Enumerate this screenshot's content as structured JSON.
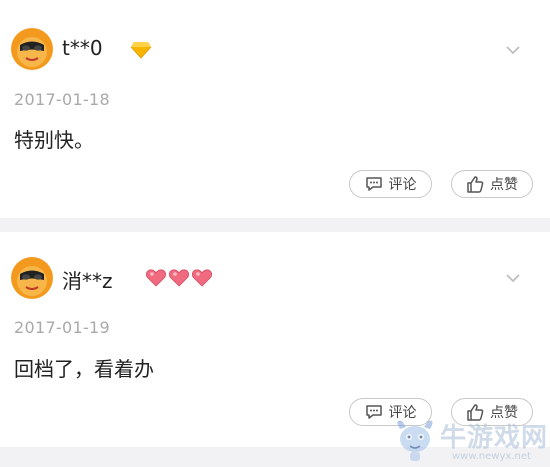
{
  "comments": [
    {
      "username": "t**0",
      "badge": "diamond-icon",
      "date": "2017-01-18",
      "text": "特别快。",
      "comment_label": "评论",
      "like_label": "点赞"
    },
    {
      "username": "消**z",
      "badge": "hearts-icon",
      "date": "2017-01-19",
      "text": "回档了，看着办",
      "comment_label": "评论",
      "like_label": "点赞"
    }
  ],
  "watermark": {
    "name": "牛游戏网",
    "url": "www.newyx.net"
  },
  "colors": {
    "background": "#f2f2f4",
    "card": "#ffffff",
    "date": "#a9a9a9",
    "avatar_orange": "#f39a1e",
    "diamond": "#f7b500",
    "heart": "#f06b7f"
  }
}
